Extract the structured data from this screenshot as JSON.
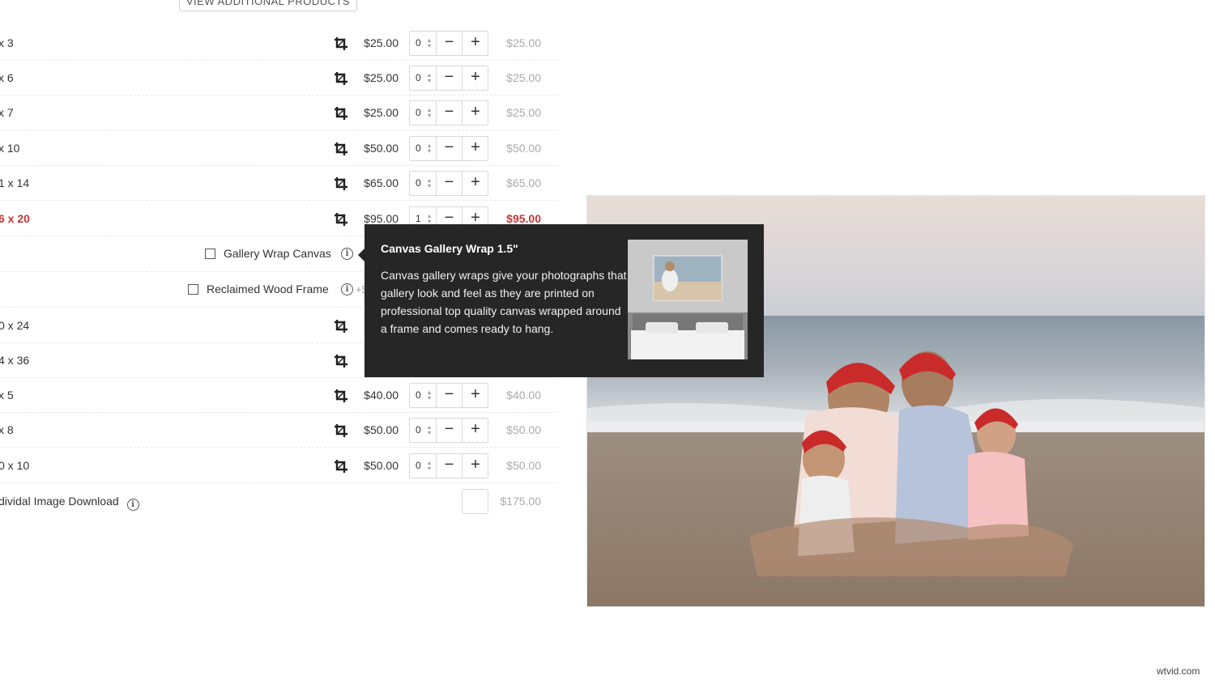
{
  "header": {
    "view_additional_label": "VIEW ADDITIONAL PRODUCTS"
  },
  "products": [
    {
      "name": "x 3",
      "price": "$25.00",
      "qty": "0",
      "total": "$25.00",
      "selected": false
    },
    {
      "name": "x 6",
      "price": "$25.00",
      "qty": "0",
      "total": "$25.00",
      "selected": false
    },
    {
      "name": "x 7",
      "price": "$25.00",
      "qty": "0",
      "total": "$25.00",
      "selected": false
    },
    {
      "name": "x 10",
      "price": "$50.00",
      "qty": "0",
      "total": "$50.00",
      "selected": false
    },
    {
      "name": "1 x 14",
      "price": "$65.00",
      "qty": "0",
      "total": "$65.00",
      "selected": false
    },
    {
      "name": "6 x 20",
      "price": "$95.00",
      "qty": "1",
      "total": "$95.00",
      "selected": true
    },
    {
      "name": "0 x 24",
      "price": "$",
      "qty": "",
      "total": "",
      "selected": false
    },
    {
      "name": "4 x 36",
      "price": "$",
      "qty": "",
      "total": "",
      "selected": false
    },
    {
      "name": "x 5",
      "price": "$40.00",
      "qty": "0",
      "total": "$40.00",
      "selected": false
    },
    {
      "name": "x 8",
      "price": "$50.00",
      "qty": "0",
      "total": "$50.00",
      "selected": false
    },
    {
      "name": "0 x 10",
      "price": "$50.00",
      "qty": "0",
      "total": "$50.00",
      "selected": false
    }
  ],
  "options": [
    {
      "label": "Gallery Wrap Canvas",
      "extra": ""
    },
    {
      "label": "Reclaimed Wood Frame",
      "extra": "+$"
    }
  ],
  "download": {
    "label": "dividal Image Download",
    "total": "$175.00"
  },
  "tooltip": {
    "title": "Canvas Gallery Wrap 1.5\"",
    "body": "Canvas gallery wraps give your photographs that gallery look and feel as they are printed on professional top quality canvas wrapped around a frame and comes ready to hang."
  },
  "icons": {
    "crop": "crop-icon",
    "info": "info-icon",
    "minus": "minus-icon",
    "plus": "plus-icon"
  },
  "controls": {
    "minus_glyph": "−",
    "plus_glyph": "+",
    "info_glyph": "i"
  },
  "colors": {
    "accent": "#cc3333",
    "tooltip_bg": "#262626",
    "muted": "#aaaaaa"
  },
  "watermark": "wtvid.com"
}
